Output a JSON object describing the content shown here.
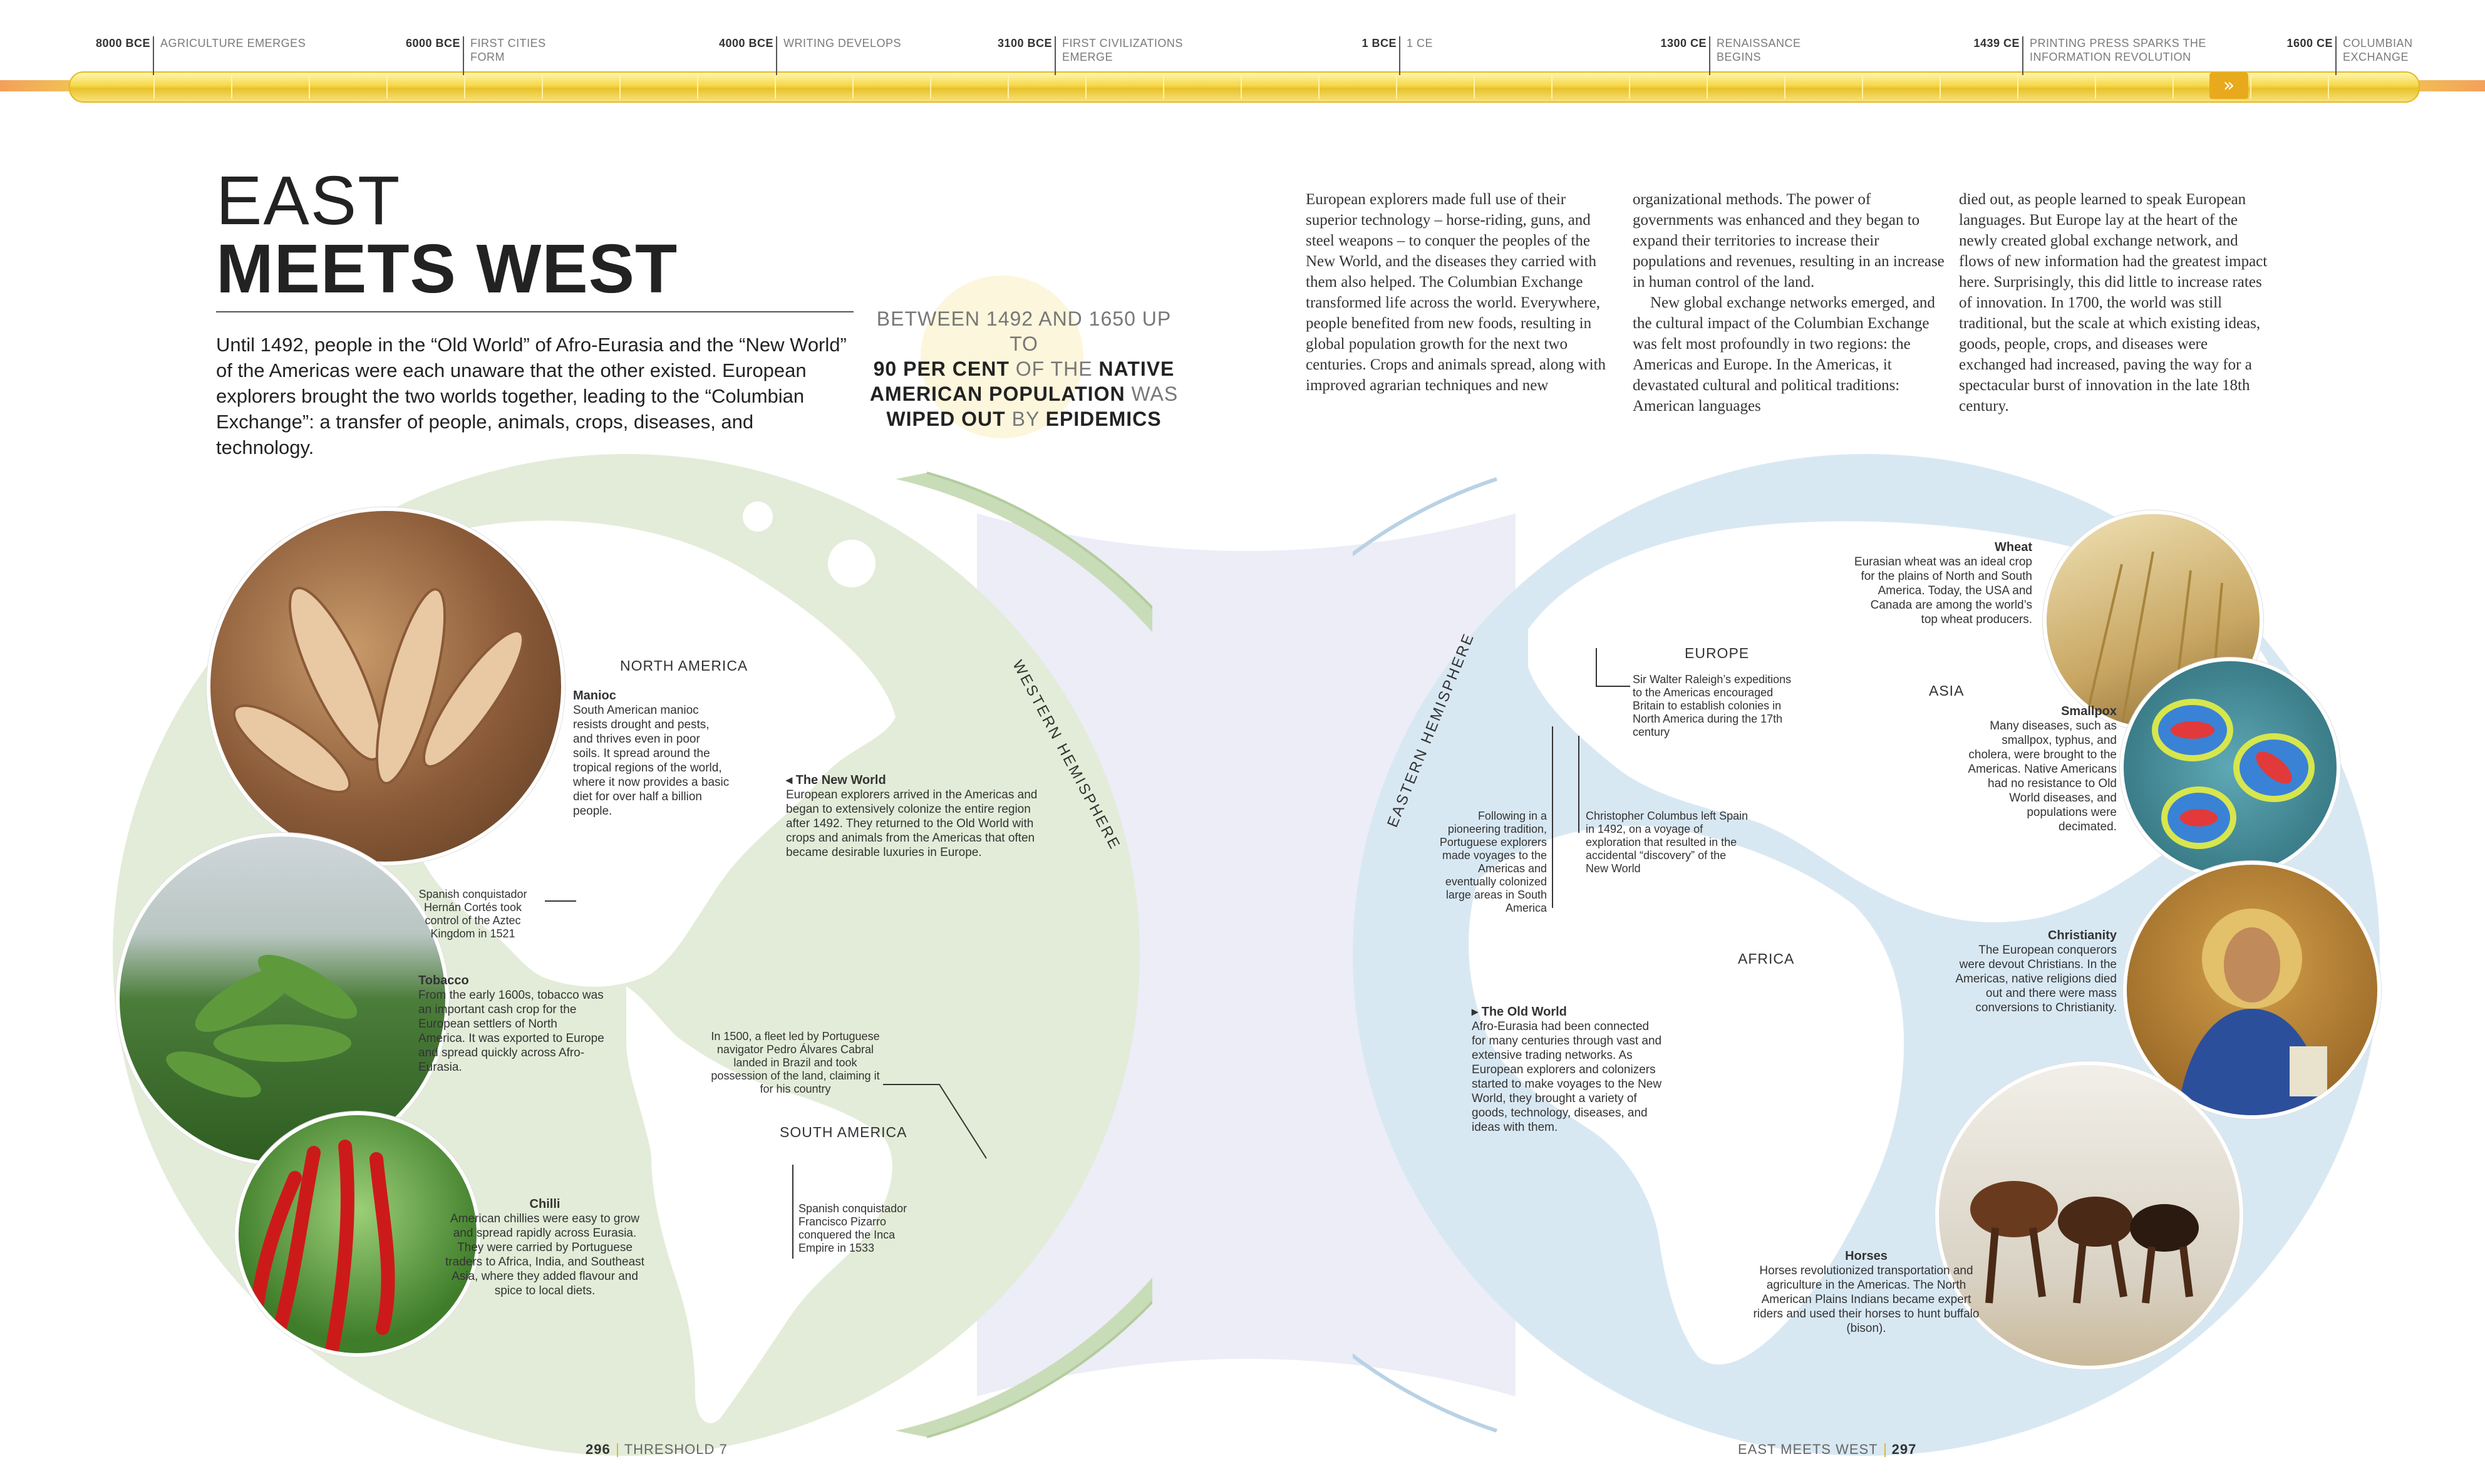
{
  "timeline": [
    {
      "date": "8000 BCE",
      "label": "AGRICULTURE EMERGES"
    },
    {
      "date": "6000 BCE",
      "label": "FIRST CITIES FORM"
    },
    {
      "date": "4000 BCE",
      "label": "WRITING DEVELOPS"
    },
    {
      "date": "3100 BCE",
      "label": "FIRST CIVILIZATIONS EMERGE"
    },
    {
      "date": "1 BCE",
      "label": "1 CE"
    },
    {
      "date": "1300 CE",
      "label": "RENAISSANCE BEGINS"
    },
    {
      "date": "1439 CE",
      "label": "PRINTING PRESS SPARKS THE INFORMATION REVOLUTION"
    },
    {
      "date": "1600 CE",
      "label": "COLUMBIAN EXCHANGE"
    }
  ],
  "timeline_arrow": "»",
  "title": {
    "line1": "EAST",
    "line2": "MEETS WEST"
  },
  "intro": "Until 1492, people in the “Old World” of Afro-Eurasia and the “New World” of the Americas were each unaware that the other existed. European explorers brought the two worlds together, leading to the “Columbian Exchange”: a transfer of people, animals, crops, diseases, and technology.",
  "pullquote": {
    "p1": "BETWEEN 1492 AND 1650 UP TO",
    "p2": "90 PER CENT",
    "p3": " OF THE ",
    "p4": "NATIVE AMERICAN POPULATION",
    "p5": " WAS ",
    "p6": "WIPED OUT",
    "p7": " BY ",
    "p8": "EPIDEMICS"
  },
  "body_columns": [
    "European explorers made full use of their superior technology – horse-riding, guns, and steel weapons – to conquer the peoples of the New World, and the diseases they carried with them also helped. The Columbian Exchange transformed life across the world. Everywhere, people benefited from new foods, resulting in global population growth for the next two centuries. Crops and animals spread, along with improved agrarian techniques and new",
    "organizational methods. The power of governments was enhanced and they began to expand their territories to increase their populations and revenues, resulting in an increase in human control of the land.",
    "New global exchange networks emerged, and the cultural impact of the Columbian Exchange was felt most profoundly in two regions: the Americas and Europe. In the Americas, it devastated cultural and political traditions: American languages",
    "died out, as people learned to speak European languages. But Europe lay at the heart of the newly created global exchange network, and flows of new information had the greatest impact here. Surprisingly, this did little to increase rates of innovation. In 1700, the world was still traditional, but the scale at which existing ideas, goods, people, crops, and diseases were exchanged had increased, paving the way for a spectacular burst of innovation in the late 18th century."
  ],
  "west": {
    "hemisphere_label": "WESTERN HEMISPHERE",
    "regions": {
      "north": "NORTH AMERICA",
      "south": "SOUTH AMERICA"
    },
    "new_world": {
      "heading": "◂ The New World",
      "text": "European explorers arrived in the Americas and began to extensively colonize the entire region after 1492. They returned to the Old World with crops and animals from the Americas that often became desirable luxuries in Europe."
    },
    "manioc": {
      "heading": "Manioc",
      "text": "South American manioc resists drought and pests, and thrives even in poor soils. It spread around the tropical regions of the world, where it now provides a basic diet for over half a billion people."
    },
    "cortes": "Spanish conquistador Hernán Cortés took control of the Aztec Kingdom in 1521",
    "tobacco": {
      "heading": "Tobacco",
      "text": "From the early 1600s, tobacco was an important cash crop for the European settlers of North America. It was exported to Europe and spread quickly across Afro-Eurasia."
    },
    "cabral": "In 1500, a fleet led by Portuguese navigator Pedro Álvares Cabral landed in Brazil and took possession of the land, claiming it for his country",
    "pizarro": "Spanish conquistador Francisco Pizarro conquered the Inca Empire in 1533",
    "chilli": {
      "heading": "Chilli",
      "text": "American chillies were easy to grow and spread rapidly across Eurasia. They were carried by Portuguese traders to Africa, India, and Southeast Asia, where they added flavour and spice to local diets."
    }
  },
  "east": {
    "hemisphere_label": "EASTERN HEMISPHERE",
    "regions": {
      "europe": "EUROPE",
      "asia": "ASIA",
      "africa": "AFRICA"
    },
    "raleigh": "Sir Walter Raleigh’s expeditions to the Americas encouraged Britain to establish colonies in North America during the 17th century",
    "portuguese": "Following in a pioneering tradition, Portuguese explorers made voyages to the Americas and eventually colonized large areas in South America",
    "columbus": "Christopher Columbus left Spain in 1492, on a voyage of exploration that resulted in the accidental “discovery” of the New World",
    "old_world": {
      "heading": "▸ The Old World",
      "text": "Afro-Eurasia had been connected for many centuries through vast and extensive trading networks. As European explorers and colonizers started to make voyages to the New World, they brought a variety of goods, technology, diseases, and ideas with them."
    },
    "wheat": {
      "heading": "Wheat",
      "text": "Eurasian wheat was an ideal crop for the plains of North and South America. Today, the USA and Canada are among the world’s top wheat producers."
    },
    "smallpox": {
      "heading": "Smallpox",
      "text": "Many diseases, such as smallpox, typhus, and cholera, were brought to the Americas. Native Americans had no resistance to Old World diseases, and populations were decimated."
    },
    "christianity": {
      "heading": "Christianity",
      "text": "The European conquerors were devout Christians. In the Americas, native religions died out and there were mass conversions to Christianity."
    },
    "horses": {
      "heading": "Horses",
      "text": "Horses revolutionized transportation and agriculture in the Americas. The North American Plains Indians became expert riders and used their horses to hunt buffalo (bison)."
    }
  },
  "footer": {
    "left_page": "296",
    "left_section": "THRESHOLD 7",
    "right_section": "EAST MEETS WEST",
    "right_page": "297"
  },
  "colors": {
    "accent": "#e9c12a",
    "west": "#e3ecd8",
    "east": "#d8e8f3",
    "connector": "#ecedf7"
  }
}
